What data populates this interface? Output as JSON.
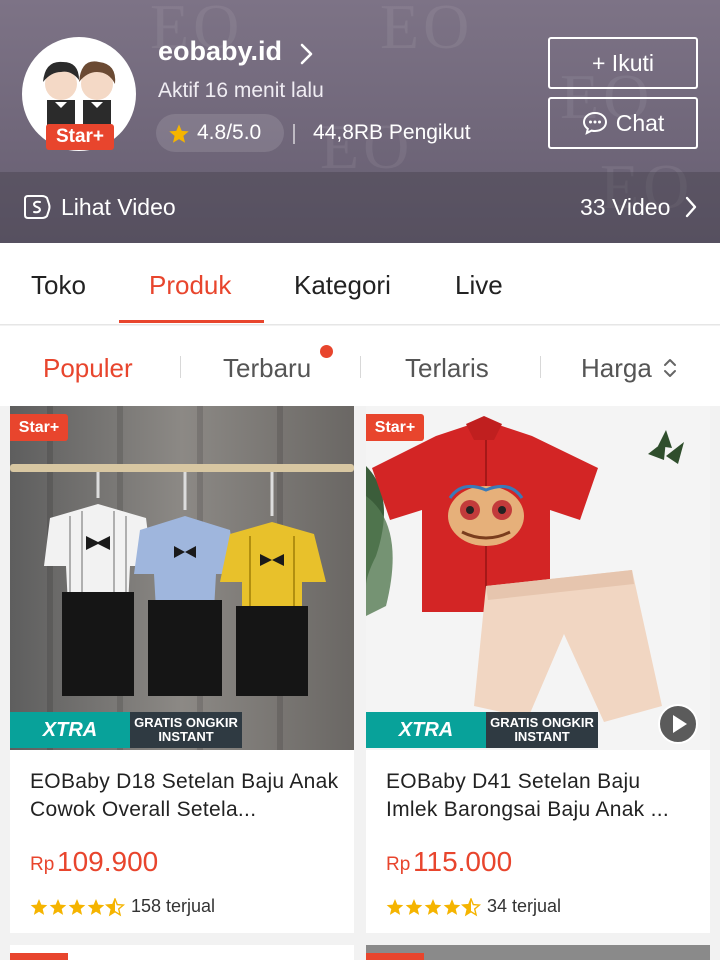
{
  "shop": {
    "name": "eobaby.id",
    "badge": "Star+",
    "active_status": "Aktif 16 menit lalu",
    "rating": "4.8/5.0",
    "followers": "44,8RB Pengikut",
    "follow_label": "+ Ikuti",
    "chat_label": "Chat",
    "video_label": "Lihat Video",
    "video_count": "33 Video",
    "colors": {
      "accent": "#e8452d",
      "header_bg": "#756c80"
    }
  },
  "tabs": [
    {
      "label": "Toko",
      "active": false
    },
    {
      "label": "Produk",
      "active": true
    },
    {
      "label": "Kategori",
      "active": false
    },
    {
      "label": "Live",
      "active": false
    }
  ],
  "sort": [
    {
      "label": "Populer",
      "active": true
    },
    {
      "label": "Terbaru",
      "active": false,
      "new_dot": true
    },
    {
      "label": "Terlaris",
      "active": false
    },
    {
      "label": "Harga",
      "active": false,
      "icon": "sort-updown-icon"
    }
  ],
  "products": [
    {
      "badge": "Star+",
      "title": "EOBaby D18 Setelan Baju Anak Cowok Overall Setela...",
      "currency": "Rp",
      "price": "109.900",
      "rating_stars": 4.5,
      "sold": "158 terjual",
      "promo_1": "XTRA",
      "promo_2": "GRATIS ONGKIR INSTANT",
      "has_video": false
    },
    {
      "badge": "Star+",
      "title": "EOBaby D41 Setelan Baju Imlek Barongsai Baju Anak ...",
      "currency": "Rp",
      "price": "115.000",
      "rating_stars": 4.5,
      "sold": "34 terjual",
      "promo_1": "XTRA",
      "promo_2": "GRATIS ONGKIR INSTANT",
      "has_video": true
    }
  ]
}
